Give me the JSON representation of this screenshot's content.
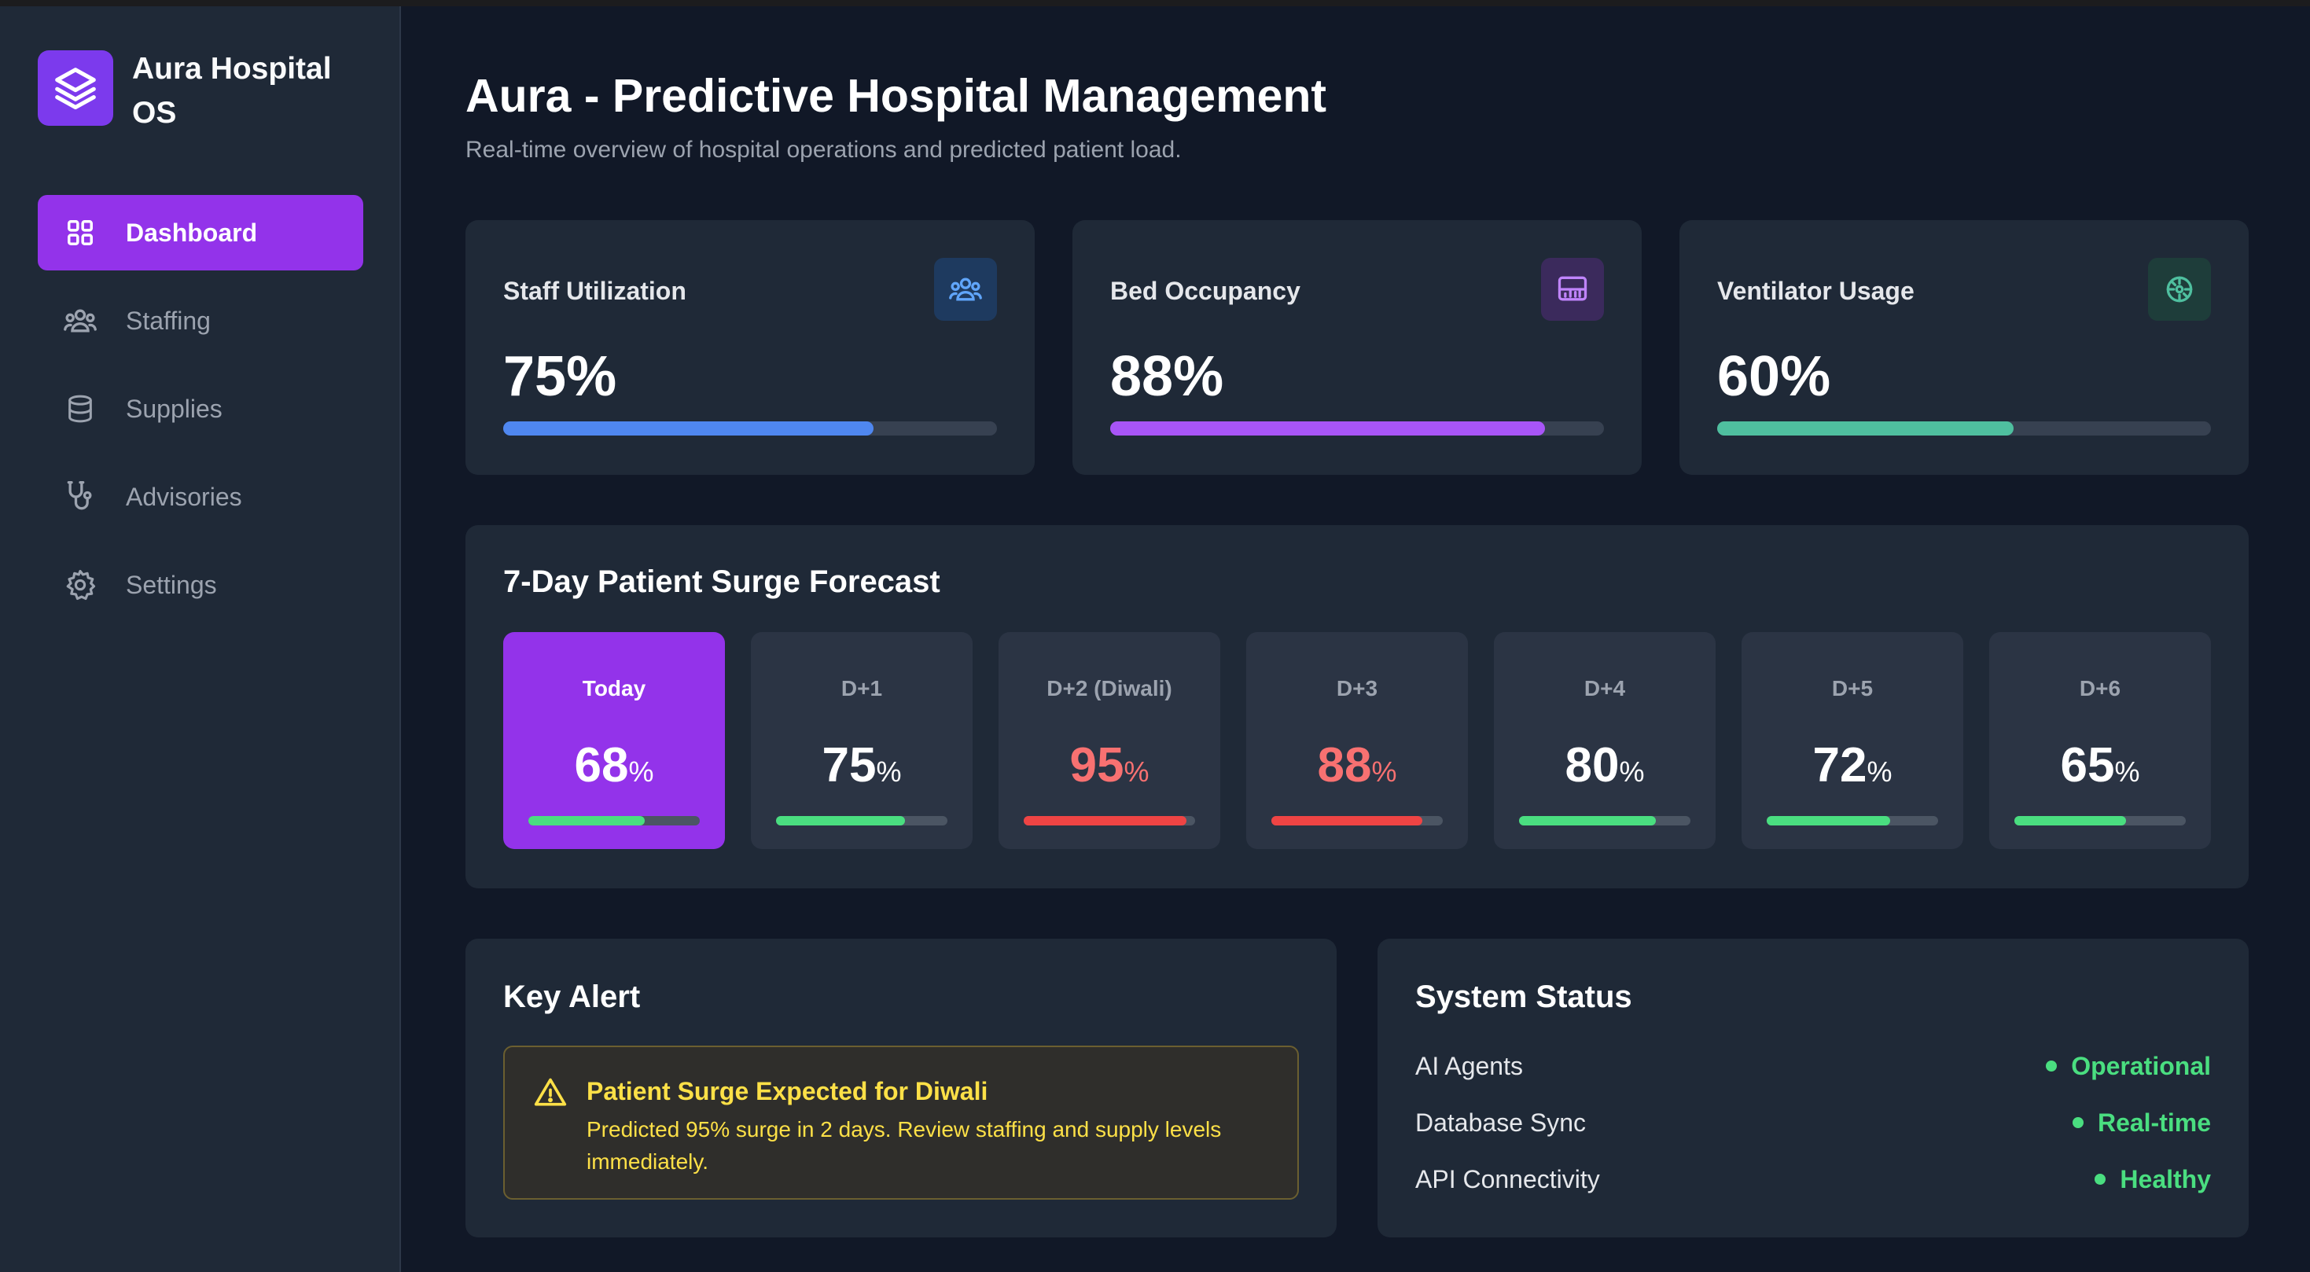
{
  "app": {
    "name": "Aura Hospital OS"
  },
  "sidebar": {
    "items": [
      {
        "label": "Dashboard",
        "icon": "grid-icon",
        "active": true
      },
      {
        "label": "Staffing",
        "icon": "users-icon"
      },
      {
        "label": "Supplies",
        "icon": "database-icon"
      },
      {
        "label": "Advisories",
        "icon": "stethoscope-icon"
      },
      {
        "label": "Settings",
        "icon": "gear-icon"
      }
    ]
  },
  "header": {
    "title": "Aura - Predictive Hospital Management",
    "subtitle": "Real-time overview of hospital operations and predicted patient load."
  },
  "stats": [
    {
      "label": "Staff Utilization",
      "value": "75%",
      "level": 0.75,
      "color": "#4f87f0",
      "icon": "users-icon"
    },
    {
      "label": "Bed Occupancy",
      "value": "88%",
      "level": 0.88,
      "color": "#a855f7",
      "icon": "bed-monitor-icon"
    },
    {
      "label": "Ventilator Usage",
      "value": "60%",
      "level": 0.6,
      "color": "#4fbf9f",
      "icon": "ventilator-icon"
    }
  ],
  "forecast": {
    "title": "7-Day Patient Surge Forecast",
    "unit": "%",
    "days": [
      {
        "label": "Today",
        "value": "68",
        "level": 0.68,
        "status": "normal"
      },
      {
        "label": "D+1",
        "value": "75",
        "level": 0.75,
        "status": "normal"
      },
      {
        "label": "D+2 (Diwali)",
        "value": "95",
        "level": 0.95,
        "status": "critical"
      },
      {
        "label": "D+3",
        "value": "88",
        "level": 0.88,
        "status": "critical"
      },
      {
        "label": "D+4",
        "value": "80",
        "level": 0.8,
        "status": "normal"
      },
      {
        "label": "D+5",
        "value": "72",
        "level": 0.72,
        "status": "normal"
      },
      {
        "label": "D+6",
        "value": "65",
        "level": 0.65,
        "status": "normal"
      }
    ],
    "colors": {
      "normal": "#4ade80",
      "critical": "#ef4444"
    }
  },
  "key_alert": {
    "title": "Key Alert",
    "alert_title": "Patient Surge Expected for Diwali",
    "alert_text": "Predicted 95% surge in 2 days. Review staffing and supply levels immediately.",
    "icon": "warning-triangle-icon"
  },
  "system_status": {
    "title": "System Status",
    "rows": [
      {
        "label": "AI Agents",
        "value": "Operational"
      },
      {
        "label": "Database Sync",
        "value": "Real-time"
      },
      {
        "label": "API Connectivity",
        "value": "Healthy"
      }
    ]
  }
}
